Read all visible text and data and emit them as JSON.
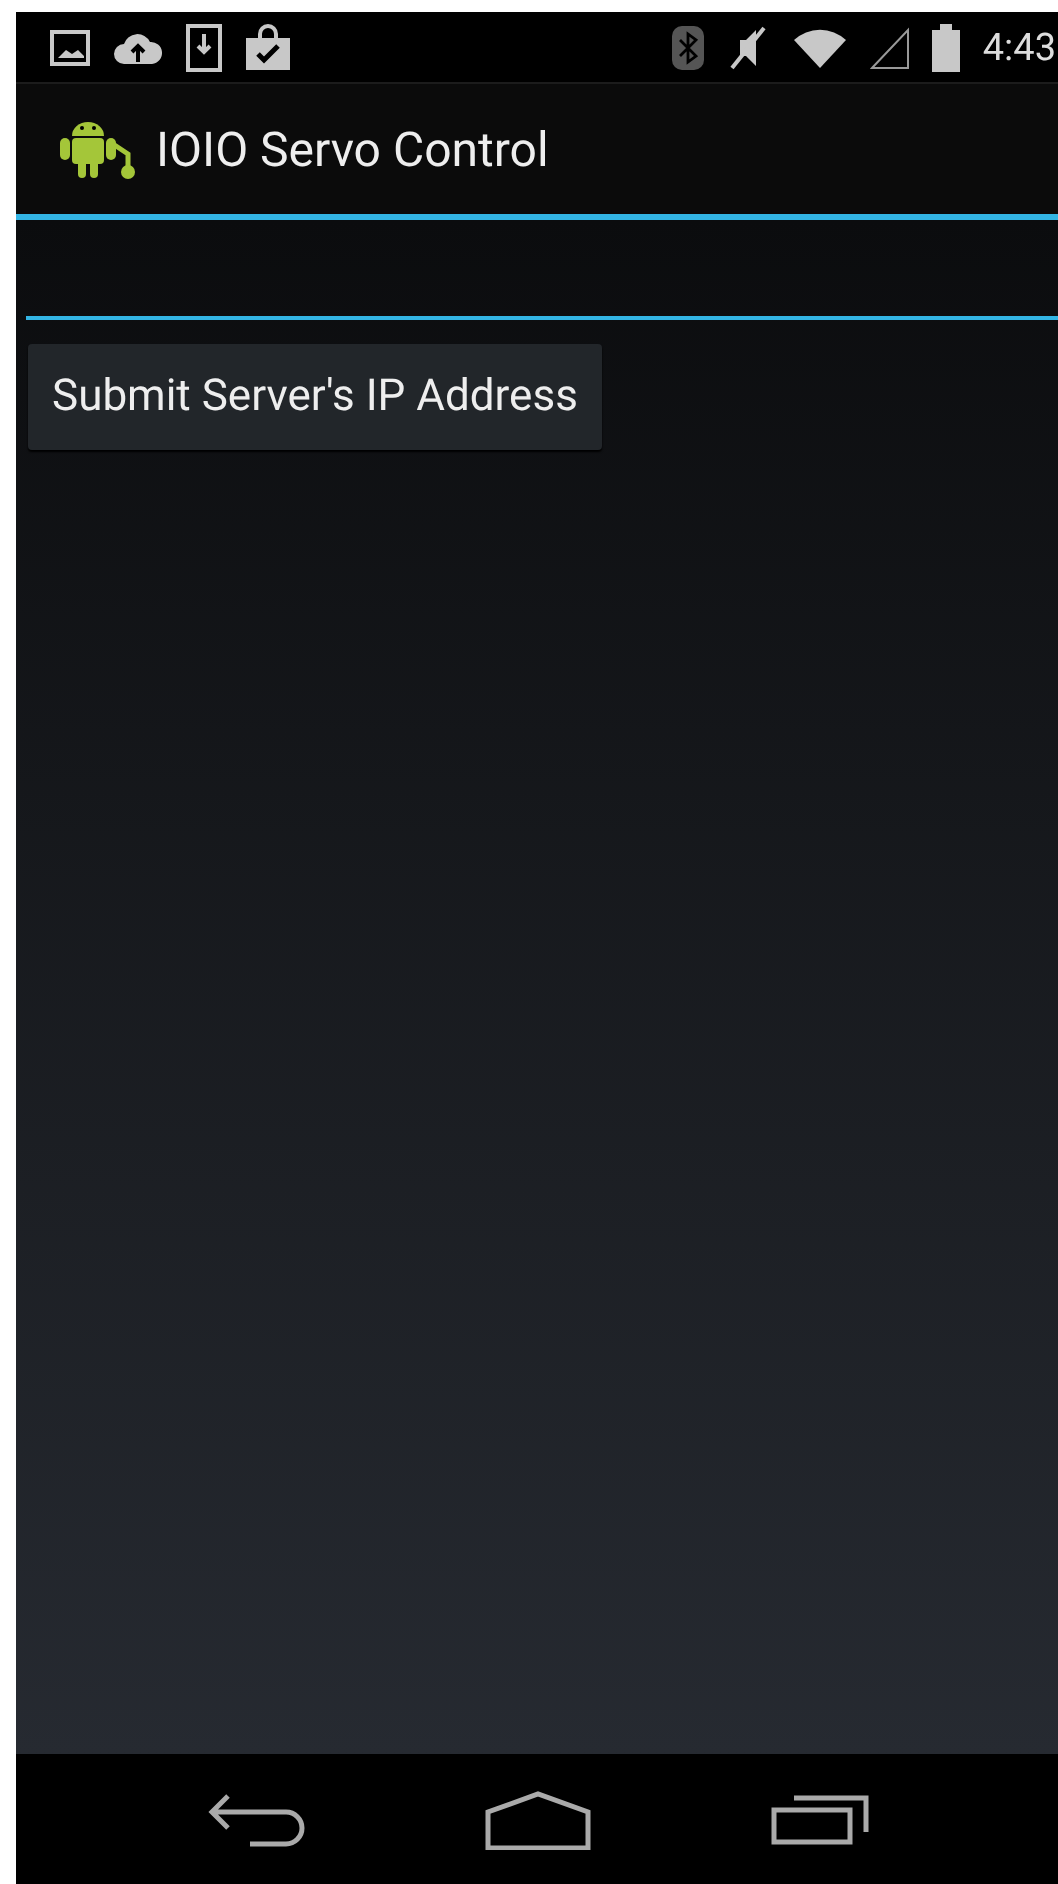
{
  "status_bar": {
    "time": "4:43"
  },
  "action_bar": {
    "title": "IOIO Servo Control"
  },
  "ip_field": {
    "focused": true
  },
  "submit_button": {
    "label": "Submit Server's IP Address"
  }
}
